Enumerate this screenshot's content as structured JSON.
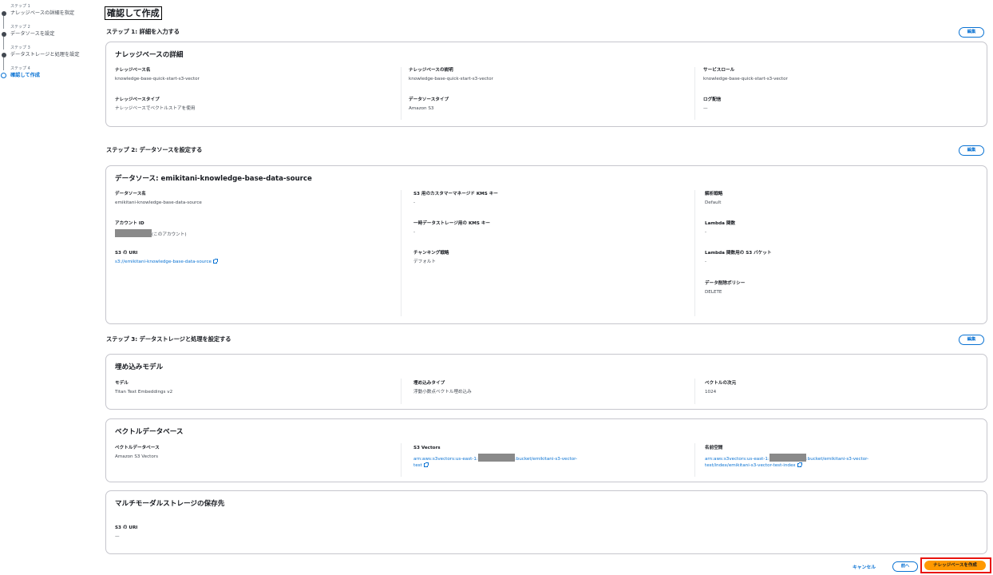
{
  "steps": [
    {
      "num": "ステップ 1",
      "label": "ナレッジベースの詳細を指定"
    },
    {
      "num": "ステップ 2",
      "label": "データソースを設定"
    },
    {
      "num": "ステップ 3",
      "label": "データストレージと処理を設定"
    },
    {
      "num": "ステップ 4",
      "label": "確認して作成"
    }
  ],
  "page_title": "確認して作成",
  "edit_label": "編集",
  "step1": {
    "title": "ステップ 1: 詳細を入力する",
    "card_title": "ナレッジベースの詳細",
    "fields": [
      {
        "k": "ナレッジベース名",
        "v": "knowledge-base-quick-start-s3-vector"
      },
      {
        "k": "ナレッジベースの説明",
        "v": "knowledge-base-quick-start-s3-vector"
      },
      {
        "k": "サービスロール",
        "v": "knowledge-base-quick-start-s3-vector"
      },
      {
        "k": "ナレッジベースタイプ",
        "v": "ナレッジベースでベクトルストアを使用"
      },
      {
        "k": "データソースタイプ",
        "v": "Amazon S3"
      },
      {
        "k": "ログ配信",
        "v": "—"
      }
    ]
  },
  "step2": {
    "title": "ステップ 2: データソースを設定する",
    "card_title": "データソース: emikitani-knowledge-base-data-source",
    "fields": [
      {
        "k": "データソース名",
        "v": "emikitani-knowledge-base-data-source"
      },
      {
        "k": "アカウント ID",
        "v": "(このアカウント)"
      },
      {
        "k": "S3 の URI",
        "v": "s3://emikitani-knowledge-base-data-source"
      },
      {
        "k": "S3 用のカスタマーマネージド KMS キー",
        "v": "-"
      },
      {
        "k": "一時データストレージ用の KMS キー",
        "v": "-"
      },
      {
        "k": "チャンキング戦略",
        "v": "デフォルト"
      },
      {
        "k": "解析戦略",
        "v": "Default"
      },
      {
        "k": "Lambda 関数",
        "v": "-"
      },
      {
        "k": "Lambda 関数用の S3 バケット",
        "v": "-"
      },
      {
        "k": "データ削除ポリシー",
        "v": "DELETE"
      }
    ]
  },
  "step3": {
    "title": "ステップ 3: データストレージと処理を設定する",
    "embed_title": "埋め込みモデル",
    "embed_fields": [
      {
        "k": "モデル",
        "v": "Titan Text Embeddings  v2"
      },
      {
        "k": "埋め込みタイプ",
        "v": "浮動小数点ベクトル埋め込み"
      },
      {
        "k": "ベクトルの次元",
        "v": "1024"
      }
    ],
    "vector_title": "ベクトルデータベース",
    "vector_fields": [
      {
        "k": "ベクトルデータベース",
        "v": "Amazon S3 Vectors"
      },
      {
        "k": "S3 Vectors",
        "v1": "arn:aws:s3vectors:us-east-1:",
        "v2": ":bucket/emikitani-s3-vector-",
        "v3": "test"
      },
      {
        "k": "名前空間",
        "v1": "arn:aws:s3vectors:us-east-1:",
        "v2": ":bucket/emikitani-s3-vector-",
        "v3": "test/index/emikitani-s3-vector-test-index"
      }
    ],
    "mm_title": "マルチモーダルストレージの保存先",
    "mm_fields": [
      {
        "k": "S3 の URI",
        "v": "—"
      }
    ]
  },
  "footer": {
    "cancel": "キャンセル",
    "prev": "前へ",
    "create": "ナレッジベースを作成"
  },
  "colors": {
    "accent": "#0972d3",
    "primary_button": "#ff9900",
    "highlight_border": "#e8140e"
  }
}
